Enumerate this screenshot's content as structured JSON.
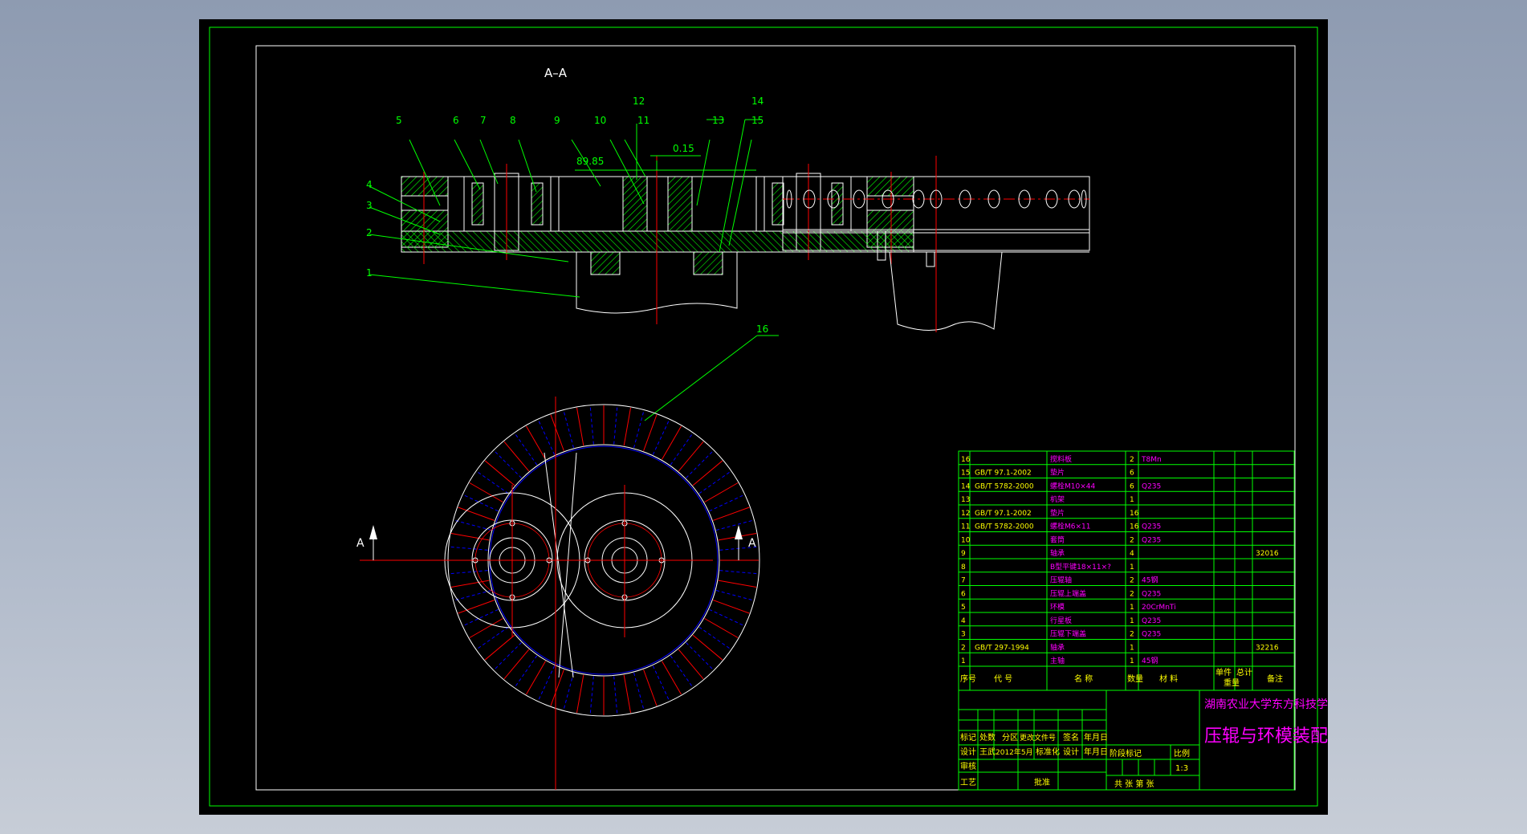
{
  "drawing": {
    "section_label": "A–A",
    "cut_marker": "A",
    "dimensions": {
      "center_distance": "89.85",
      "clearance": "0.15"
    },
    "balloons": [
      "1",
      "2",
      "3",
      "4",
      "5",
      "6",
      "7",
      "8",
      "9",
      "10",
      "11",
      "12",
      "13",
      "14",
      "15",
      "16"
    ]
  },
  "bom": {
    "rows": [
      {
        "no": "16",
        "code": "",
        "name": "搅料板",
        "qty": "2",
        "material": "T8Mn",
        "note": ""
      },
      {
        "no": "15",
        "code": "GB/T 97.1-2002",
        "name": "垫片",
        "qty": "6",
        "material": "",
        "note": ""
      },
      {
        "no": "14",
        "code": "GB/T 5782-2000",
        "name": "螺栓M10×44",
        "qty": "6",
        "material": "Q235",
        "note": ""
      },
      {
        "no": "13",
        "code": "",
        "name": "机架",
        "qty": "1",
        "material": "",
        "note": ""
      },
      {
        "no": "12",
        "code": "GB/T 97.1-2002",
        "name": "垫片",
        "qty": "16",
        "material": "",
        "note": ""
      },
      {
        "no": "11",
        "code": "GB/T 5782-2000",
        "name": "螺栓M6×11",
        "qty": "16",
        "material": "Q235",
        "note": ""
      },
      {
        "no": "10",
        "code": "",
        "name": "套筒",
        "qty": "2",
        "material": "Q235",
        "note": ""
      },
      {
        "no": "9",
        "code": "",
        "name": "轴承",
        "qty": "4",
        "material": "",
        "note": "32016"
      },
      {
        "no": "8",
        "code": "",
        "name": "B型平键18×11×?",
        "qty": "1",
        "material": "",
        "note": ""
      },
      {
        "no": "7",
        "code": "",
        "name": "压辊轴",
        "qty": "2",
        "material": "45钢",
        "note": ""
      },
      {
        "no": "6",
        "code": "",
        "name": "压辊上端盖",
        "qty": "2",
        "material": "Q235",
        "note": ""
      },
      {
        "no": "5",
        "code": "",
        "name": "环模",
        "qty": "1",
        "material": "20CrMnTi",
        "note": ""
      },
      {
        "no": "4",
        "code": "",
        "name": "行星板",
        "qty": "1",
        "material": "Q235",
        "note": ""
      },
      {
        "no": "3",
        "code": "",
        "name": "压辊下端盖",
        "qty": "2",
        "material": "Q235",
        "note": ""
      },
      {
        "no": "2",
        "code": "GB/T 297-1994",
        "name": "轴承",
        "qty": "1",
        "material": "",
        "note": "32216"
      },
      {
        "no": "1",
        "code": "",
        "name": "主轴",
        "qty": "1",
        "material": "45钢",
        "note": ""
      }
    ],
    "header": {
      "no": "序号",
      "code": "代 号",
      "name": "名 称",
      "qty": "数量",
      "material": "材 料",
      "unit_weight": "单件",
      "total_weight": "总计",
      "weight": "重量",
      "note": "备注"
    }
  },
  "title_block": {
    "school": "湖南农业大学东方科技学院",
    "drawing_title": "压辊与环模装配图",
    "scale_label": "比例",
    "scale_value": "1:3",
    "stage_mark": "阶段标记",
    "sheet_info": "共 张 第 张",
    "row1": [
      "标记",
      "处数",
      "分区",
      "更改文件号",
      "签名",
      "年月日"
    ],
    "row2": [
      "设计",
      "王武",
      "2012年5月",
      "标准化",
      "设计",
      "年月日"
    ],
    "review": "审核",
    "process": "工艺",
    "approve": "批准"
  },
  "colors": {
    "background": "#000000",
    "frame": "#00ff00",
    "centerline": "#ff0000",
    "text_magenta": "#ff00ff",
    "text_yellow": "#ffff00",
    "outline": "#ffffff",
    "hatch": "#00ff00",
    "blue": "#0000ff"
  }
}
